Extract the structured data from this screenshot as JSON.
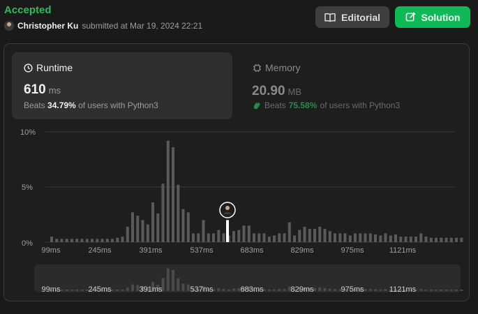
{
  "header": {
    "status": "Accepted",
    "user": "Christopher Ku",
    "submitted_text": "submitted at Mar 19, 2024 22:21"
  },
  "buttons": {
    "editorial": "Editorial",
    "solution": "Solution"
  },
  "runtime": {
    "title": "Runtime",
    "value": "610",
    "unit": "ms",
    "beats_prefix": "Beats",
    "beats_pct": "34.79%",
    "beats_suffix": "of users with Python3"
  },
  "memory": {
    "title": "Memory",
    "value": "20.90",
    "unit": "MB",
    "beats_prefix": "Beats",
    "beats_pct": "75.58%",
    "beats_suffix": "of users with Python3"
  },
  "colors": {
    "accepted": "#2cbb5d",
    "solution_btn": "#0dba56",
    "bar": "#5a5a5a",
    "user_bar": "#ffffff"
  },
  "chart_data": {
    "type": "bar",
    "ylabel": "",
    "xlabel": "",
    "y_ticks": [
      "10%",
      "5%",
      "0%"
    ],
    "ylim": [
      0,
      10
    ],
    "x_tick_labels": [
      "99ms",
      "245ms",
      "391ms",
      "537ms",
      "683ms",
      "829ms",
      "975ms",
      "1121ms"
    ],
    "user_runtime": "610ms",
    "user_bar_value": 1.5,
    "values": [
      0.5,
      0.3,
      0.3,
      0.3,
      0.3,
      0.3,
      0.3,
      0.3,
      0.3,
      0.3,
      0.3,
      0.3,
      0.3,
      0.4,
      0.5,
      1.4,
      2.7,
      2.4,
      2.0,
      1.6,
      3.6,
      2.6,
      5.3,
      9.2,
      8.6,
      5.2,
      3.0,
      2.7,
      0.8,
      0.8,
      2.0,
      0.8,
      0.8,
      1.1,
      0.8,
      0.6,
      1.0,
      1.1,
      1.5,
      1.5,
      0.8,
      0.8,
      0.8,
      0.5,
      0.6,
      0.8,
      0.8,
      1.8,
      0.6,
      1.1,
      1.4,
      1.2,
      1.2,
      1.4,
      1.2,
      1.0,
      0.8,
      0.8,
      0.8,
      0.6,
      0.8,
      0.8,
      0.8,
      0.8,
      0.7,
      0.6,
      0.8,
      0.6,
      0.7,
      0.5,
      0.5,
      0.5,
      0.5,
      0.8,
      0.5,
      0.4,
      0.4,
      0.4,
      0.4,
      0.4,
      0.4,
      0.4
    ],
    "grid": true,
    "legend": "none"
  }
}
